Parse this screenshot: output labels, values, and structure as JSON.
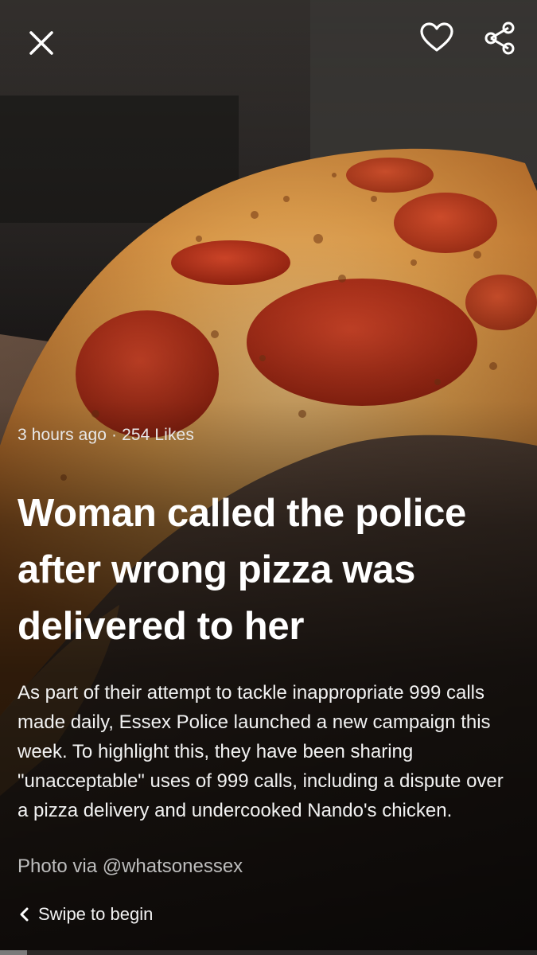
{
  "toolbar": {
    "close_icon": "close-icon",
    "like_icon": "heart-icon",
    "share_icon": "share-icon"
  },
  "story": {
    "time_ago": "3 hours ago",
    "separator": "·",
    "likes": "254 Likes",
    "headline": "Woman called the police after wrong pizza was delivered to her",
    "body": "As part of their attempt to tackle inappropriate 999 calls made daily, Essex Police launched a new campaign this week. To highlight this, they have been sharing \"unacceptable\" uses of 999 calls, including a dispute over a pizza delivery and undercooked Nando's chicken.",
    "photo_credit": "Photo via @whatsonessex"
  },
  "footer": {
    "swipe_label": "Swipe to begin",
    "swipe_icon": "chevron-left-icon"
  },
  "progress": {
    "fraction": 0.05
  },
  "colors": {
    "pepperoni": "#b8321c",
    "cheese": "#e8a24a",
    "background": "#2a2522"
  }
}
